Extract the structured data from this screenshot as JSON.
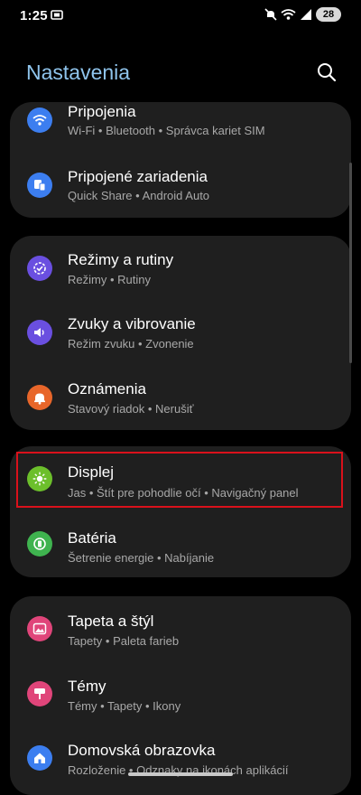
{
  "status_bar": {
    "time": "1:25",
    "battery": "28"
  },
  "header": {
    "title": "Nastavenia"
  },
  "groups": [
    {
      "items": [
        {
          "title": "Pripojenia",
          "subtitle": "Wi-Fi  •  Bluetooth  •  Správca kariet SIM",
          "icon": "wifi-icon",
          "color": "#3c7ef0"
        },
        {
          "title": "Pripojené zariadenia",
          "subtitle": "Quick Share  •  Android Auto",
          "icon": "devices-icon",
          "color": "#3c7ef0"
        }
      ]
    },
    {
      "items": [
        {
          "title": "Režimy a rutiny",
          "subtitle": "Režimy  •  Rutiny",
          "icon": "modes-icon",
          "color": "#6a4fe0"
        },
        {
          "title": "Zvuky a vibrovanie",
          "subtitle": "Režim zvuku  •  Zvonenie",
          "icon": "sound-icon",
          "color": "#6a4fe0"
        },
        {
          "title": "Oznámenia",
          "subtitle": "Stavový riadok  •  Nerušiť",
          "icon": "bell-icon",
          "color": "#e8662a"
        }
      ]
    },
    {
      "items": [
        {
          "title": "Displej",
          "subtitle": "Jas  •  Štít pre pohodlie očí  •  Navigačný panel",
          "icon": "brightness-icon",
          "color": "#6cbf2b"
        },
        {
          "title": "Batéria",
          "subtitle": "Šetrenie energie  •  Nabíjanie",
          "icon": "battery-icon",
          "color": "#3fb34f"
        }
      ]
    },
    {
      "items": [
        {
          "title": "Tapeta a štýl",
          "subtitle": "Tapety  •  Paleta farieb",
          "icon": "wallpaper-icon",
          "color": "#e0457a"
        },
        {
          "title": "Témy",
          "subtitle": "Témy  •  Tapety  •  Ikony",
          "icon": "themes-icon",
          "color": "#e0457a"
        },
        {
          "title": "Domovská obrazovka",
          "subtitle": "Rozloženie  •  Odznaky na ikonách aplikácií",
          "icon": "home-icon",
          "color": "#3c7ef0"
        }
      ]
    }
  ]
}
